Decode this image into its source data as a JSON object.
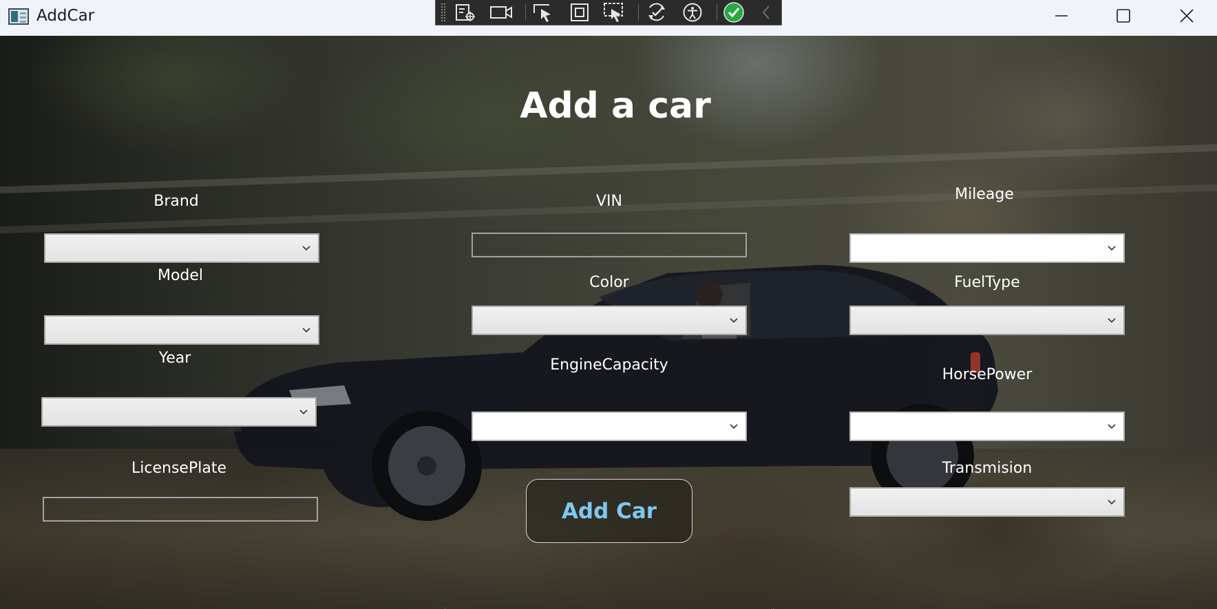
{
  "window": {
    "title": "AddCar",
    "icon": "app-window-icon",
    "controls": [
      "minimize-icon",
      "maximize-icon",
      "close-icon"
    ]
  },
  "debug_toolbar": {
    "tools": [
      "select-element-icon",
      "record-icon",
      "select-cursor-icon",
      "display-layout-icon",
      "track-focus-icon",
      "hot-reload-icon",
      "accessibility-icon",
      "binding-ok-icon",
      "collapse-chevron-icon"
    ]
  },
  "form": {
    "heading": "Add a car",
    "fields": {
      "brand": {
        "label": "Brand",
        "value": ""
      },
      "model": {
        "label": "Model",
        "value": ""
      },
      "year": {
        "label": "Year",
        "value": ""
      },
      "license_plate": {
        "label": "LicensePlate",
        "value": ""
      },
      "vin": {
        "label": "VIN",
        "value": ""
      },
      "color": {
        "label": "Color",
        "value": ""
      },
      "engine_capacity": {
        "label": "EngineCapacity",
        "value": ""
      },
      "mileage": {
        "label": "Mileage",
        "value": ""
      },
      "fuel_type": {
        "label": "FuelType",
        "value": ""
      },
      "horse_power": {
        "label": "HorsePower",
        "value": ""
      },
      "transmission": {
        "label": "Transmision",
        "value": ""
      }
    },
    "submit_label": "Add Car"
  },
  "colors": {
    "title_bar_bg": "#f0f3f9",
    "heading_text": "#ffffff",
    "button_text": "#7fc7ee",
    "close_icon": "#1a1a1a"
  }
}
